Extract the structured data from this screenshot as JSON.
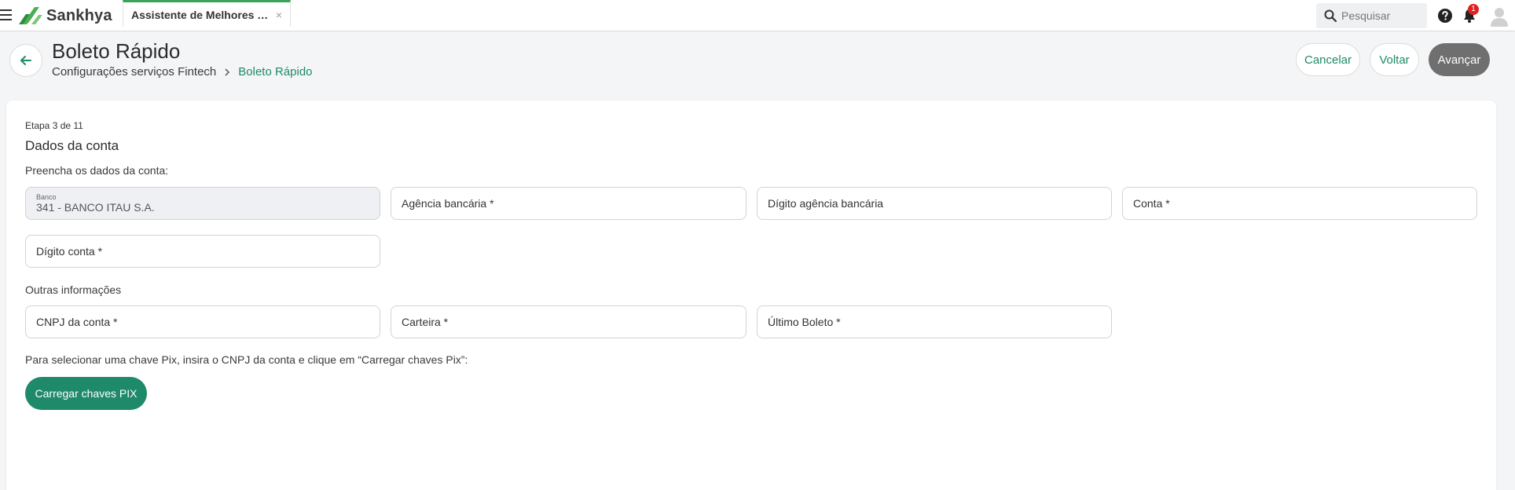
{
  "topbar": {
    "logo_text": "Sankhya",
    "tab_label": "Assistente de Melhores Pr...",
    "tab_close": "×",
    "search_placeholder": "Pesquisar",
    "notification_count": "1"
  },
  "header": {
    "title": "Boleto Rápido",
    "breadcrumb": [
      "Configurações serviços Fintech",
      "Boleto Rápido"
    ],
    "buttons": {
      "cancel": "Cancelar",
      "back": "Voltar",
      "next": "Avançar"
    }
  },
  "form": {
    "step": "Etapa 3 de 11",
    "section_title": "Dados da conta",
    "instruction": "Preencha os dados da conta:",
    "bank": {
      "label": "Banco",
      "value": "341 - BANCO ITAU S.A."
    },
    "fields": {
      "agency": "Agência bancária *",
      "agency_digit": "Dígito agência bancária",
      "account": "Conta *",
      "account_digit": "Dígito conta *"
    },
    "other_info_title": "Outras informações",
    "other_fields": {
      "cnpj": "CNPJ da conta *",
      "wallet": "Carteira *",
      "last_boleto": "Último Boleto *"
    },
    "pix_instruction": "Para selecionar uma chave Pix, insira o CNPJ da conta e clique em “Carregar chaves Pix”:",
    "pix_button": "Carregar chaves PIX"
  },
  "colors": {
    "accent": "#1e8a6a",
    "tab_indicator": "#3aa55a",
    "next_button": "#6f6f6f",
    "badge": "#e02020"
  },
  "icons": [
    "menu-icon",
    "sankhya-logo-icon",
    "close-icon",
    "search-icon",
    "help-icon",
    "bell-icon",
    "avatar-icon",
    "arrow-left-icon",
    "chevron-right-icon"
  ]
}
